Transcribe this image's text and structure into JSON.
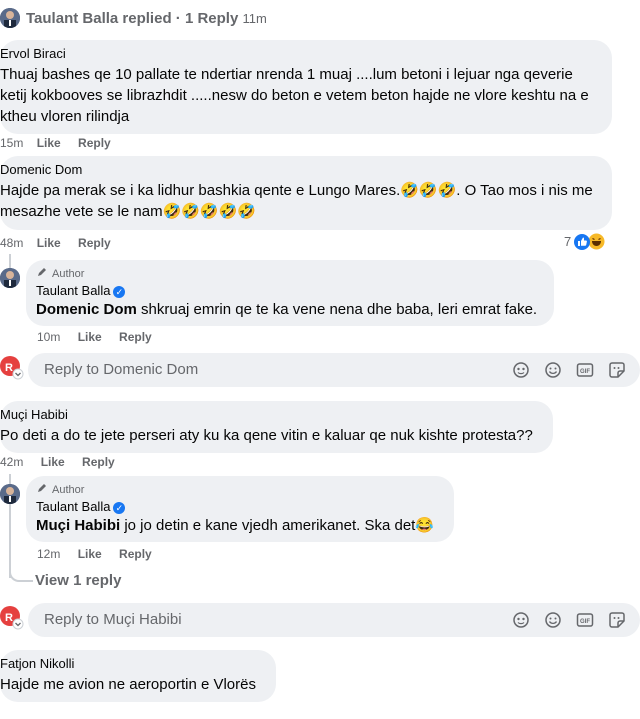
{
  "header": {
    "name": "Taulant Balla",
    "action": "replied",
    "count": "· 1 Reply",
    "time": "11m"
  },
  "comments": [
    {
      "name": "Ervol Biraci",
      "text": "Thuaj bashes qe 10 pallate te ndertiar nrenda 1 muaj ....lum betoni i lejuar nga qeverie ketij kokbooves se librazhdit .....nesw do beton e vetem beton hajde ne vlore keshtu na e ktheu vloren rilindja",
      "time": "15m",
      "like": "Like",
      "reply": "Reply"
    },
    {
      "name": "Domenic Dom",
      "text": "Hajde pa merak se i ka lidhur bashkia qente e Lungo Mares.🤣🤣🤣. O Tao mos i nis me mesazhe vete se le nam🤣🤣🤣🤣🤣",
      "time": "48m",
      "like": "Like",
      "reply": "Reply",
      "reaction_count": "7"
    },
    {
      "name": "Muçi Habibi",
      "text": "Po deti a do te jete perseri aty ku ka qene vitin e kaluar qe nuk kishte protesta??",
      "time": "42m",
      "like": "Like",
      "reply": "Reply"
    },
    {
      "name": "Fatjon Nikolli",
      "text": "Hajde me avion ne aeroportin e Vlorës"
    }
  ],
  "replies": [
    {
      "badge": "Author",
      "name": "Taulant Balla",
      "mention": "Domenic Dom",
      "text": " shkruaj emrin qe te ka vene nena dhe baba, leri emrat fake.",
      "time": "10m",
      "like": "Like",
      "reply": "Reply"
    },
    {
      "badge": "Author",
      "name": "Taulant Balla",
      "mention": "Muçi Habibi",
      "text": " jo jo detin e kane vjedh amerikanet. Ska det😂",
      "time": "12m",
      "like": "Like",
      "reply": "Reply"
    }
  ],
  "reply_boxes": [
    {
      "placeholder": "Reply to Domenic Dom"
    },
    {
      "placeholder": "Reply to Muçi Habibi"
    }
  ],
  "view_replies": "View 1 reply",
  "colors": {
    "bubble": "#eef0f3",
    "meta": "#65676b",
    "verified": "#1877f2",
    "like_reaction": "#1877f2"
  },
  "icons": [
    "pen-icon",
    "verified-icon",
    "sticker-icon",
    "emoji-icon",
    "gif-icon",
    "avatar-sticker-icon",
    "like-reaction-icon",
    "haha-reaction-icon"
  ]
}
